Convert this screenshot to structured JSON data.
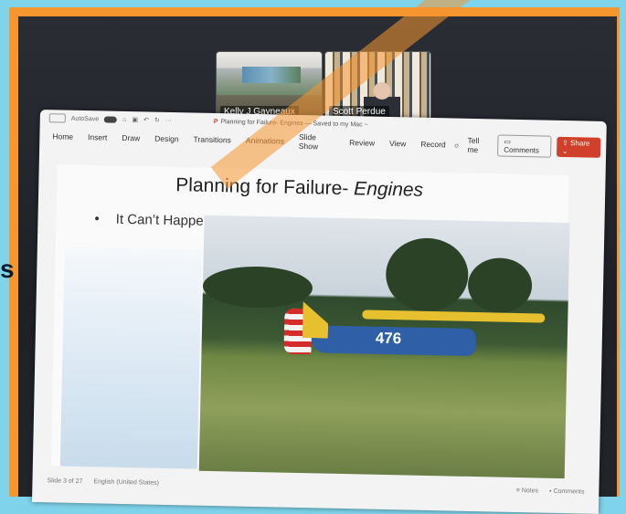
{
  "zoom": {
    "participants": [
      {
        "name": "Kelly J Gayneaux"
      },
      {
        "name": "Scott Perdue"
      }
    ]
  },
  "window": {
    "autosave_label": "AutoSave",
    "document_title": "Planning for Failure- Engines — Saved to my Mac ~"
  },
  "ribbon": {
    "tabs": [
      "Home",
      "Insert",
      "Draw",
      "Design",
      "Transitions",
      "Animations",
      "Slide Show",
      "Review",
      "View",
      "Record"
    ],
    "tell_me": "Tell me",
    "comments_label": "Comments",
    "share_label": "Share"
  },
  "slide": {
    "title_main": "Planning for Failure- ",
    "title_italic": "Engines",
    "bullet": "It Can’t Happen to Me",
    "plane_number": "476"
  },
  "status": {
    "slide_counter": "Slide 3 of 27",
    "language": "English (United States)",
    "notes_label": "Notes",
    "comments_label": "Comments"
  },
  "colors": {
    "frame": "#f5962f",
    "background": "#7fd3ea",
    "share_button": "#d0402a"
  }
}
